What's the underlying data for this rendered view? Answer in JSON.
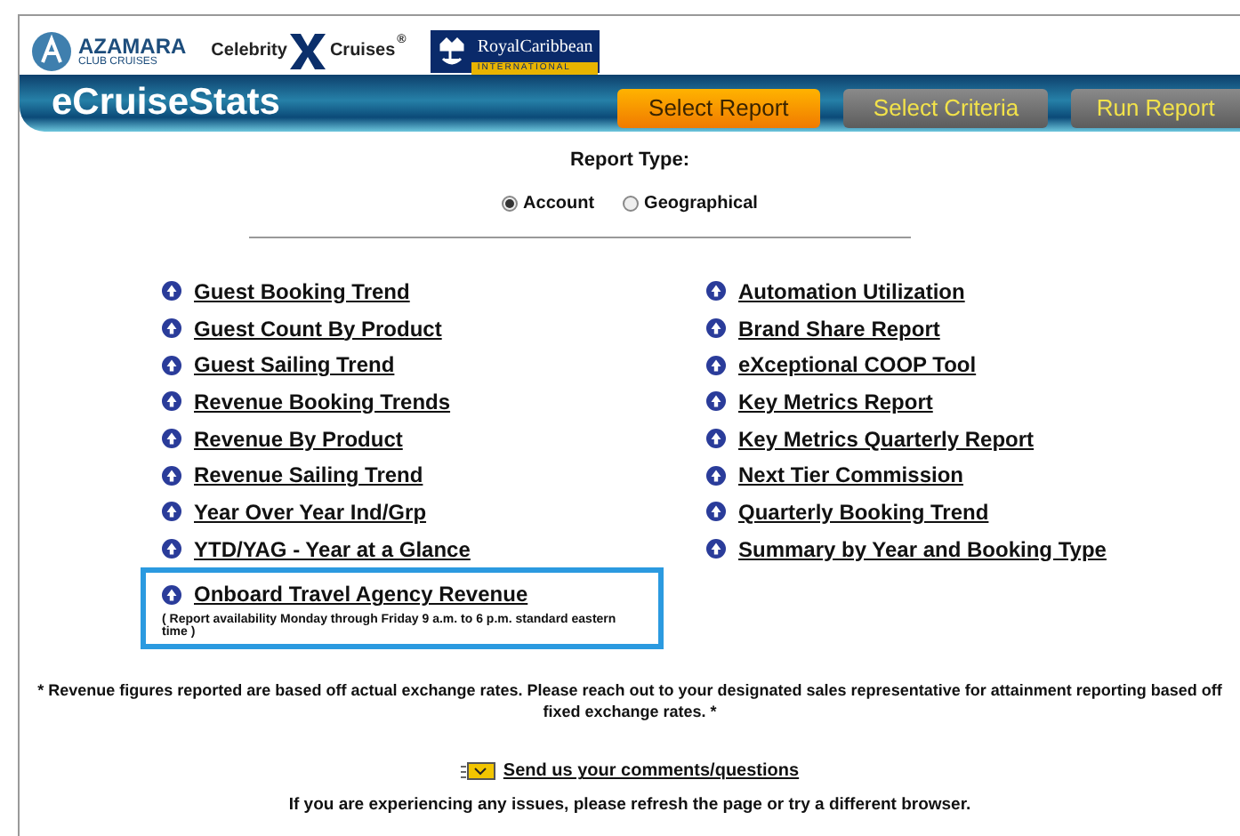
{
  "logos": {
    "azamara": {
      "name": "AZAMARA",
      "sub": "CLUB CRUISES"
    },
    "celebrity": {
      "left": "Celebrity",
      "right": "Cruises",
      "mark": "®"
    },
    "royal": {
      "name": "RoyalCaribbean",
      "sub": "INTERNATIONAL"
    }
  },
  "banner": {
    "title": "eCruiseStats"
  },
  "tabs": [
    {
      "label": "Select Report",
      "selected": true
    },
    {
      "label": "Select Criteria",
      "selected": false
    },
    {
      "label": "Run Report",
      "selected": false
    }
  ],
  "report_type": {
    "label": "Report Type:",
    "options": [
      {
        "label": "Account",
        "selected": true
      },
      {
        "label": "Geographical",
        "selected": false
      }
    ]
  },
  "reports_left": [
    {
      "label": "Guest Booking Trend"
    },
    {
      "label": "Guest Count By Product"
    },
    {
      "label": "Guest Sailing Trend"
    },
    {
      "label": "Revenue Booking Trends"
    },
    {
      "label": "Revenue By Product"
    },
    {
      "label": "Revenue Sailing Trend"
    },
    {
      "label": "Year Over Year Ind/Grp"
    },
    {
      "label": "YTD/YAG - Year at a Glance"
    },
    {
      "label": "Onboard Travel Agency Revenue",
      "highlighted": true,
      "note": "( Report availability Monday through Friday 9 a.m. to 6 p.m. standard eastern time )"
    }
  ],
  "reports_right": [
    {
      "label": "Automation Utilization"
    },
    {
      "label": "Brand Share Report"
    },
    {
      "label": "eXceptional COOP Tool"
    },
    {
      "label": "Key Metrics Report"
    },
    {
      "label": "Key Metrics Quarterly Report"
    },
    {
      "label": "Next Tier Commission"
    },
    {
      "label": "Quarterly Booking Trend"
    },
    {
      "label": "Summary by Year and Booking Type"
    }
  ],
  "footnote": "* Revenue figures reported are based off actual exchange rates. Please reach out to your designated sales representative for attainment reporting based off fixed exchange rates. *",
  "feedback_link": "Send us your comments/questions",
  "help_text": "If you are experiencing any issues, please refresh the page or try a different browser."
}
